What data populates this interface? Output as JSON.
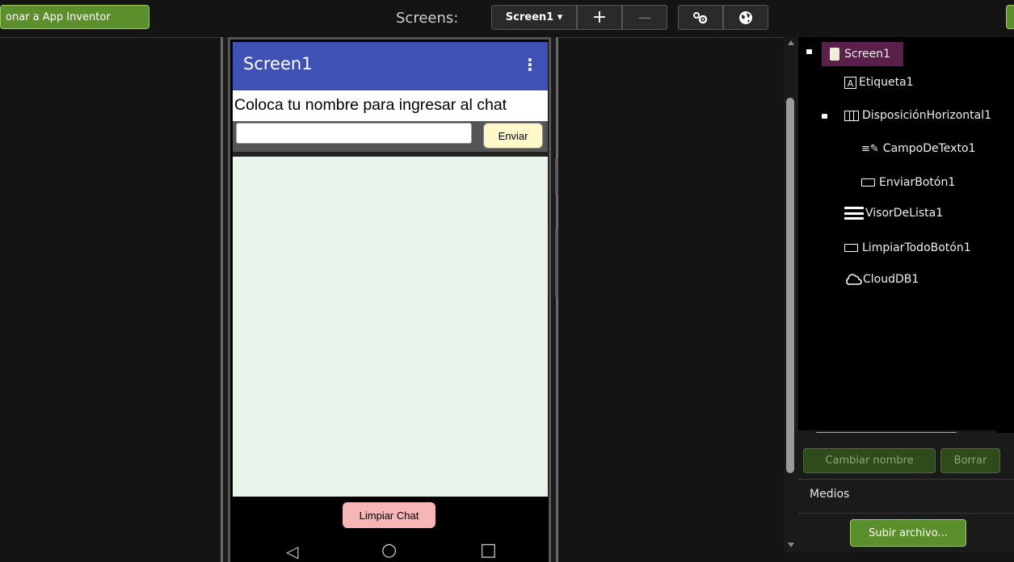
{
  "toolbar": {
    "back_label": "onar a App Inventor",
    "screens_label": "Screens:",
    "screen_select": "Screen1 ▾",
    "add_label": "+",
    "remove_label": "—"
  },
  "phone": {
    "title": "Screen1",
    "menu_glyph": "⋮",
    "label_text": "Coloca tu nombre para ingresar al chat",
    "send_button": "Enviar",
    "clear_button": "Limpiar Chat",
    "nav_back": "◁",
    "nav_home": "○",
    "nav_recent": "□"
  },
  "tree": {
    "root": "Screen1",
    "items": [
      {
        "label": "Etiqueta1",
        "icon": "label-icon"
      },
      {
        "label": "DisposiciónHorizontal1",
        "icon": "horizontal-arrangement-icon"
      },
      {
        "label": "CampoDeTexto1",
        "icon": "textbox-icon"
      },
      {
        "label": "EnviarBotón1",
        "icon": "button-icon"
      },
      {
        "label": "VisorDeLista1",
        "icon": "listview-icon"
      },
      {
        "label": "LimpiarTodoBotón1",
        "icon": "button-icon"
      },
      {
        "label": "CloudDB1",
        "icon": "cloud-icon"
      }
    ]
  },
  "actions": {
    "rename": "Cambiar nombre",
    "delete": "Borrar"
  },
  "media": {
    "title": "Medios",
    "upload": "Subir archivo..."
  },
  "colors": {
    "accent_green": "#5b8f2c",
    "appbar_blue": "#3f51b5",
    "selected_purple": "#5a1f4a"
  }
}
